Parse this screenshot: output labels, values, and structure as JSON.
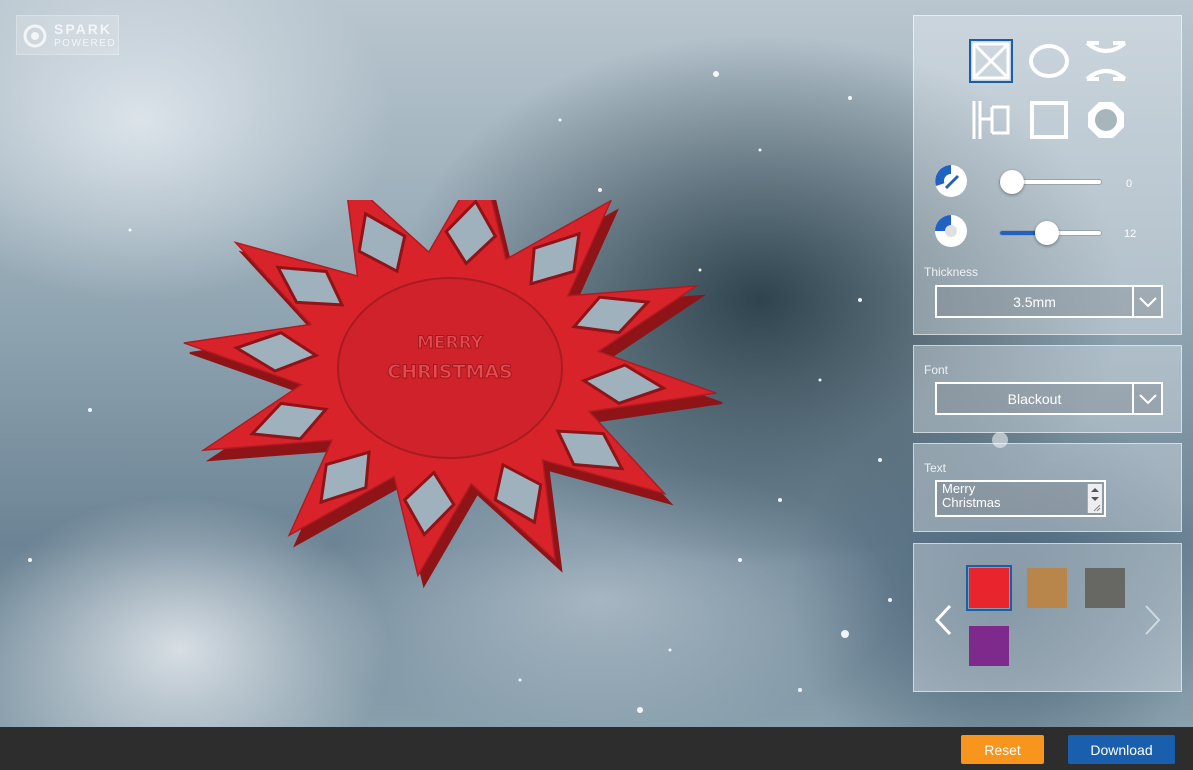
{
  "logo": {
    "line1": "SPARK",
    "line2": "POWERED"
  },
  "model": {
    "emboss_line1": "MERRY",
    "emboss_line2": "CHRISTMAS",
    "color": "#d8232a"
  },
  "shapes": {
    "items": [
      {
        "name": "x-shape",
        "selected": true
      },
      {
        "name": "ellipse-shape",
        "selected": false
      },
      {
        "name": "bowtie-shape",
        "selected": false
      },
      {
        "name": "bracket-shape",
        "selected": false
      },
      {
        "name": "square-shape",
        "selected": false
      },
      {
        "name": "gear-shape",
        "selected": false
      }
    ]
  },
  "sliders": [
    {
      "name": "rotation",
      "value": "0",
      "fraction": 0.0
    },
    {
      "name": "segments",
      "value": "12",
      "fraction": 0.44
    }
  ],
  "thickness": {
    "label": "Thickness",
    "value": "3.5mm"
  },
  "font": {
    "label": "Font",
    "value": "Blackout"
  },
  "text": {
    "label": "Text",
    "line1": "Merry",
    "line2": "Christmas"
  },
  "colors": {
    "swatches": [
      {
        "hex": "#e8242d",
        "selected": true
      },
      {
        "hex": "#b8864a",
        "selected": false
      },
      {
        "hex": "#676764",
        "selected": false
      },
      {
        "hex": "#7d2a8c",
        "selected": false
      }
    ],
    "accent": "#1b5ea8"
  },
  "footer": {
    "reset_label": "Reset",
    "reset_color": "#f7951d",
    "download_label": "Download",
    "download_color": "#1a5fae"
  }
}
